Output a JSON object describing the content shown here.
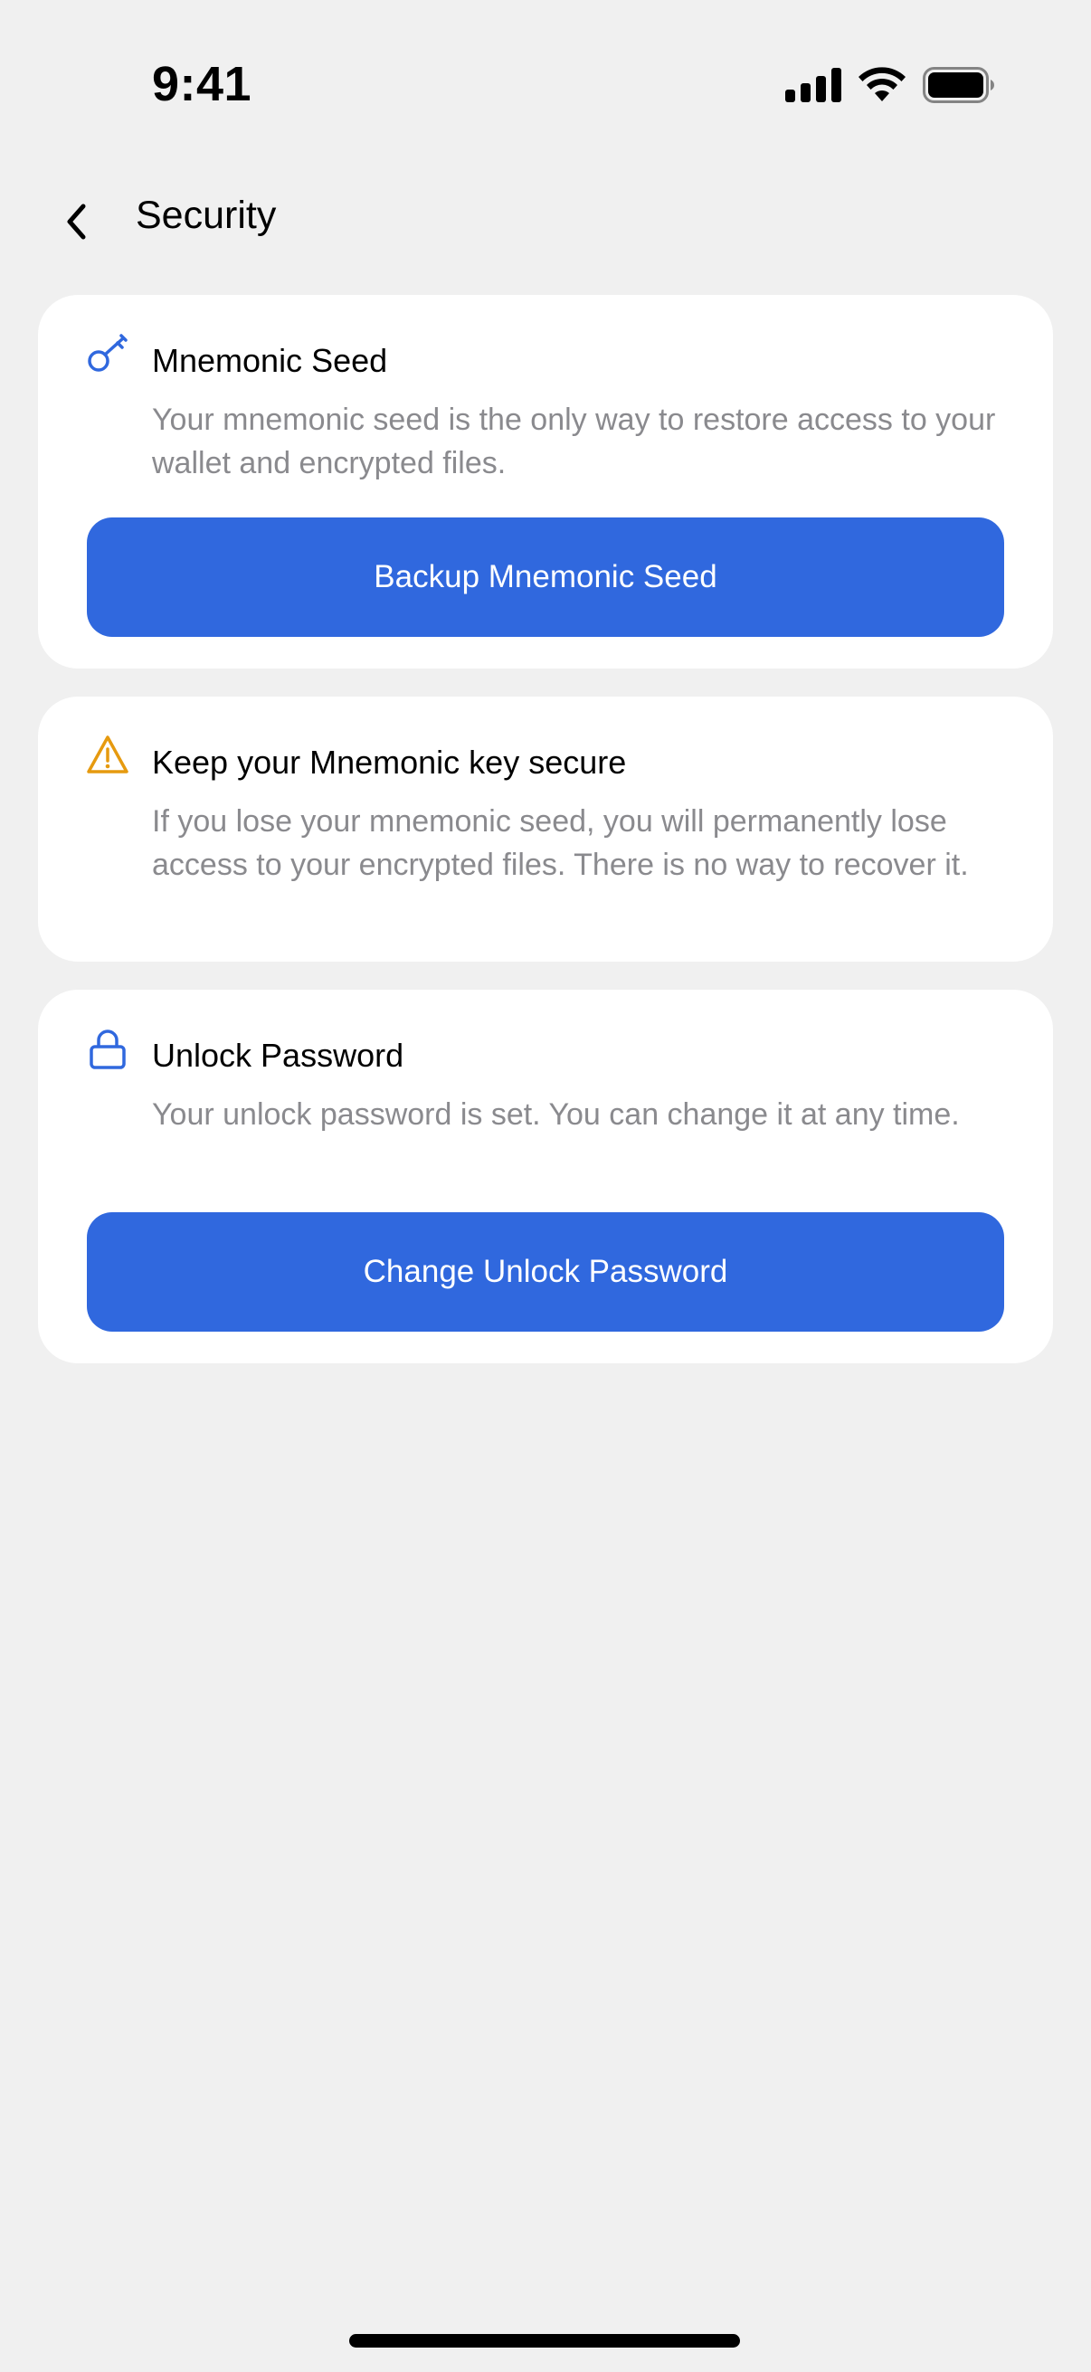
{
  "status_bar": {
    "time": "9:41",
    "icons": [
      "cellular-signal-icon",
      "wifi-icon",
      "battery-icon"
    ]
  },
  "header": {
    "back_icon": "chevron-left-icon",
    "title": "Security"
  },
  "cards": [
    {
      "icon": "key-icon",
      "title": "Mnemonic Seed",
      "description": "Your mnemonic seed is the only way to restore access to your wallet and encrypted files.",
      "button_label": "Backup Mnemonic Seed"
    },
    {
      "icon": "warning-triangle-icon",
      "title": "Keep your Mnemonic key secure",
      "description": "If you lose your mnemonic seed, you will permanently lose access to your encrypted files. There is no way to recover it."
    },
    {
      "icon": "lock-icon",
      "title": "Unlock Password",
      "description": "Your unlock password is set. You can change it at any time.",
      "button_label": "Change Unlock Password"
    }
  ],
  "colors": {
    "background": "#f0f0f0",
    "card": "#ffffff",
    "accent": "#3068de",
    "warning": "#e69a0f",
    "secondary_text": "#8a8a8e"
  }
}
